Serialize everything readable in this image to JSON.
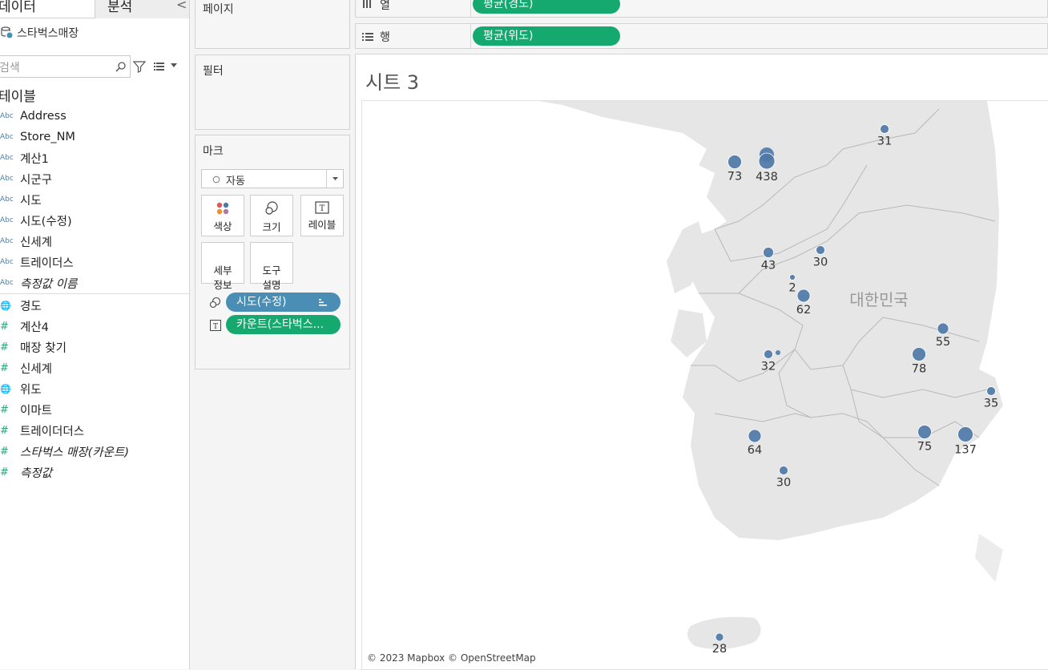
{
  "data_pane": {
    "tab_data": "데이터",
    "tab_analysis": "분석",
    "collapse_glyph": "<",
    "datasource": "스타벅스매장",
    "search_placeholder": "검색",
    "tables_header": "테이블",
    "fields": [
      {
        "type": "Abc",
        "name": "Address",
        "italic": false
      },
      {
        "type": "Abc",
        "name": "Store_NM",
        "italic": false
      },
      {
        "type": "Abc",
        "name": "계산1",
        "italic": false
      },
      {
        "type": "Abc",
        "name": "시군구",
        "italic": false
      },
      {
        "type": "Abc",
        "name": "시도",
        "italic": false
      },
      {
        "type": "Abc",
        "name": "시도(수정)",
        "italic": false
      },
      {
        "type": "Abc",
        "name": "신세계",
        "italic": false
      },
      {
        "type": "Abc",
        "name": "트레이더스",
        "italic": false
      },
      {
        "type": "Abc",
        "name": "측정값 이름",
        "italic": true
      },
      {
        "type": "geo",
        "name": "경도",
        "italic": false
      },
      {
        "type": "#",
        "name": "계산4",
        "italic": false
      },
      {
        "type": "#",
        "name": "매장 찾기",
        "italic": false
      },
      {
        "type": "#",
        "name": "신세계",
        "italic": false
      },
      {
        "type": "geo",
        "name": "위도",
        "italic": false
      },
      {
        "type": "#",
        "name": "이마트",
        "italic": false
      },
      {
        "type": "#",
        "name": "트레이더더스",
        "italic": false
      },
      {
        "type": "#",
        "name": "스타벅스 매장(카운트)",
        "italic": true
      },
      {
        "type": "#",
        "name": "측정값",
        "italic": true
      }
    ]
  },
  "shelves": {
    "pages": "페이지",
    "filters": "필터",
    "marks": "마크",
    "mark_type": "자동",
    "mark_buttons": {
      "color": "색상",
      "size": "크기",
      "label": "레이블",
      "detail": "세부\n정보",
      "tooltip": "도구\n설명"
    },
    "mark_pills": [
      "시도(수정)",
      "카운트(스타벅스..."
    ],
    "columns_label": "열",
    "rows_label": "행",
    "columns_pill": "평균(경도)",
    "rows_pill": "평균(위도)"
  },
  "view": {
    "sheet_title": "시트 3",
    "country_label": "대한민국",
    "attribution": "© 2023 Mapbox © OpenStreetMap",
    "mark_color": "#4e79a7",
    "markers": [
      {
        "label": "73",
        "value": 73
      },
      {
        "label": "438",
        "value": 438
      },
      {
        "label": "31",
        "value": 31
      },
      {
        "label": "43",
        "value": 43
      },
      {
        "label": "30",
        "value": 30
      },
      {
        "label": "2",
        "value": 2
      },
      {
        "label": "62",
        "value": 62
      },
      {
        "label": "55",
        "value": 55
      },
      {
        "label": "32",
        "value": 32
      },
      {
        "label": "78",
        "value": 78
      },
      {
        "label": "35",
        "value": 35
      },
      {
        "label": "64",
        "value": 64
      },
      {
        "label": "75",
        "value": 75
      },
      {
        "label": "137",
        "value": 137
      },
      {
        "label": "30",
        "value": 30
      },
      {
        "label": "28",
        "value": 28
      }
    ]
  }
}
